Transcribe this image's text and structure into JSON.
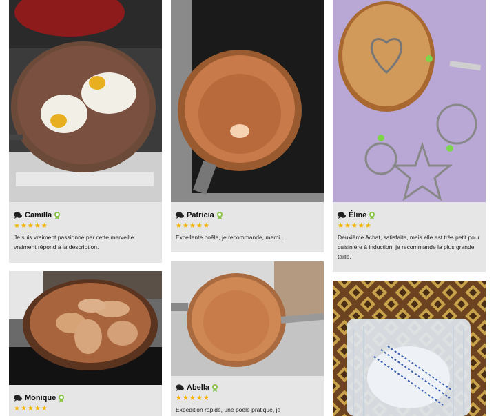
{
  "reviews": [
    {
      "name": "Camilla",
      "stars": "★★★★★",
      "rating": 5,
      "text": "Je suis vraiment passionné par cette merveille vraiment répond à la description."
    },
    {
      "name": "Patricia",
      "stars": "★★★★★",
      "rating": 5,
      "text": "Excellente poêle, je recommande, merci .."
    },
    {
      "name": "Éline",
      "stars": "★★★★★",
      "rating": 5,
      "text": "Deuxième Achat, satisfaite, mais elle est très petit pour cuisinière à induction, je recommande la plus grande taille."
    },
    {
      "name": "Monique",
      "stars": "★★★★★",
      "rating": 5,
      "text": ""
    },
    {
      "name": "Abella",
      "stars": "★★★★★",
      "rating": 5,
      "text": "Expédition rapide, une poêle pratique, je"
    }
  ],
  "icons": {
    "comment": "comment-icon",
    "badge": "verified-badge-icon"
  },
  "colors": {
    "card_bg": "#e6e6e6",
    "star": "#f4b400",
    "badge": "#8bc34a",
    "copper": "#c97a4a"
  }
}
